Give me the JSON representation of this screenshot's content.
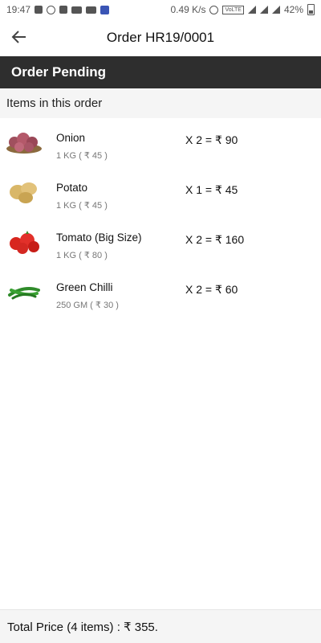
{
  "status_bar": {
    "time": "19:47",
    "network_speed": "0.49 K/s",
    "lte_badge": "VoLTE",
    "battery": "42%"
  },
  "app_bar": {
    "back_icon": "arrow-left-icon",
    "title": "Order HR19/0001"
  },
  "order_status": "Order Pending",
  "items_header": "Items in this order",
  "items": [
    {
      "name": "Onion",
      "quantity": "1 KG ( ₹ 45 )",
      "total": "X  2 = ₹ 90",
      "image": "onion"
    },
    {
      "name": "Potato",
      "quantity": "1 KG ( ₹ 45 )",
      "total": "X  1 = ₹ 45",
      "image": "potato"
    },
    {
      "name": "Tomato (Big Size)",
      "quantity": "1 KG ( ₹ 80 )",
      "total": "X  2 = ₹ 160",
      "image": "tomato"
    },
    {
      "name": "Green Chilli",
      "quantity": "250 GM ( ₹ 30 )",
      "total": "X  2 = ₹ 60",
      "image": "chilli"
    }
  ],
  "footer": {
    "total_price": "Total Price (4 items) :  ₹ 355."
  },
  "colors": {
    "pending_bar": "#2e2e2e",
    "header_bg": "#f5f5f5"
  }
}
